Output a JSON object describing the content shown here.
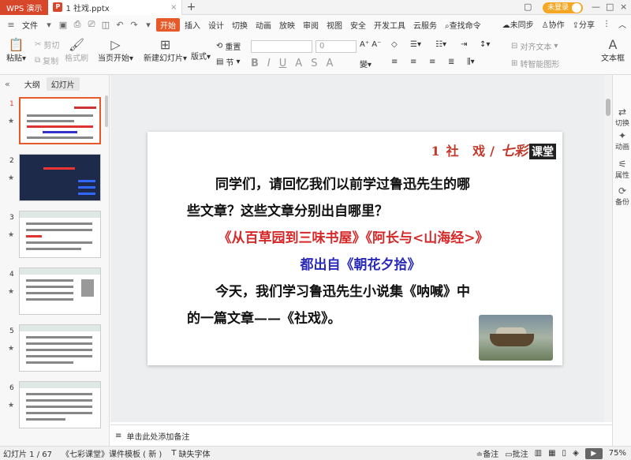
{
  "titlebar": {
    "app_label": "WPS 演示",
    "doc_tab": "1 社戏.pptx",
    "add_tab": "+",
    "login": "未登录"
  },
  "menubar": {
    "file": "文件",
    "items": [
      "开始",
      "插入",
      "设计",
      "切换",
      "动画",
      "放映",
      "审阅",
      "视图",
      "安全",
      "开发工具",
      "云服务"
    ],
    "search": "查找命令",
    "sync": "未同步",
    "collab": "协作",
    "share": "分享"
  },
  "ribbon": {
    "paste": "粘贴",
    "cut": "剪切",
    "copy": "复制",
    "format_painter": "格式刷",
    "from_current": "当页开始",
    "new_slide": "新建幻灯片",
    "layout": "版式",
    "section": "节",
    "reset": "重置",
    "size_value": "0",
    "align_text": "对齐文本",
    "smartart": "转智能图形",
    "textbox": "文本框"
  },
  "left_panel": {
    "tab_outline": "大纲",
    "tab_slides": "幻灯片",
    "thumbnails": [
      {
        "num": "1"
      },
      {
        "num": "2"
      },
      {
        "num": "3"
      },
      {
        "num": "4"
      },
      {
        "num": "5"
      },
      {
        "num": "6"
      }
    ]
  },
  "slide": {
    "header_num": "1",
    "header_title": "社 戏/",
    "header_brand": "七彩",
    "header_ketang": "课堂",
    "line1": "同学们，请回忆我们以前学过鲁迅先生的哪",
    "line2": "些文章？这些文章分别出自哪里？",
    "line3": "《从百草园到三味书屋》《阿长与<山海经>》",
    "line4": "都出自《朝花夕拾》",
    "line5": "今天，我们学习鲁迅先生小说集《呐喊》中",
    "line6": "的一篇文章——《社戏》。"
  },
  "right_sidebar": {
    "switch": "切换",
    "animation": "动画",
    "property": "属性",
    "backup": "备份"
  },
  "notes": {
    "placeholder": "单击此处添加备注"
  },
  "statusbar": {
    "slide_count": "幻灯片 1 / 67",
    "template": "《七彩课堂》课件模板 ( 新 )",
    "missing_font": "缺失字体",
    "notes": "备注",
    "comments": "批注",
    "zoom": "75%"
  }
}
